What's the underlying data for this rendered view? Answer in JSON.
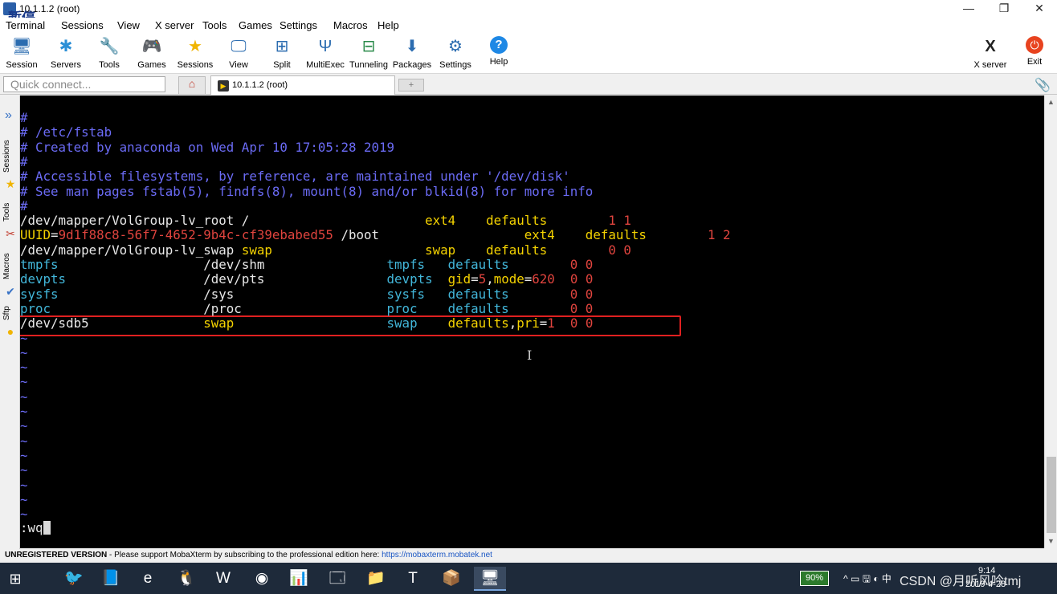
{
  "window": {
    "title": "10.1.1.2 (root)",
    "overlay_text": "暂停",
    "minimize": "—",
    "maximize": "❐",
    "close": "✕"
  },
  "menu": [
    "Terminal",
    "Sessions",
    "View",
    "X server",
    "Tools",
    "Games",
    "Settings",
    "Macros",
    "Help"
  ],
  "toolbar": [
    {
      "label": "Session",
      "icon": "session-icon",
      "glyph": "🖥",
      "color": "#2b6cb0"
    },
    {
      "label": "Servers",
      "icon": "servers-icon",
      "glyph": "✱",
      "color": "#2b8fd6"
    },
    {
      "label": "Tools",
      "icon": "tools-icon",
      "glyph": "🔧",
      "color": "#c0392b"
    },
    {
      "label": "Games",
      "icon": "games-icon",
      "glyph": "🎮",
      "color": "#555"
    },
    {
      "label": "Sessions",
      "icon": "sessions-star-icon",
      "glyph": "★",
      "color": "#f0b400"
    },
    {
      "label": "View",
      "icon": "view-icon",
      "glyph": "🖵",
      "color": "#2b6cb0"
    },
    {
      "label": "Split",
      "icon": "split-icon",
      "glyph": "⊞",
      "color": "#2b6cb0"
    },
    {
      "label": "MultiExec",
      "icon": "multiexec-icon",
      "glyph": "Ψ",
      "color": "#2b6cb0"
    },
    {
      "label": "Tunneling",
      "icon": "tunneling-icon",
      "glyph": "⊟",
      "color": "#2a8a4a"
    },
    {
      "label": "Packages",
      "icon": "packages-icon",
      "glyph": "⬇",
      "color": "#2b6cb0"
    },
    {
      "label": "Settings",
      "icon": "settings-icon",
      "glyph": "⚙",
      "color": "#2b6cb0"
    },
    {
      "label": "Help",
      "icon": "help-icon",
      "glyph": "?",
      "color": "#ffffff"
    }
  ],
  "toolbar_right": [
    {
      "label": "X server",
      "icon": "xserver-icon",
      "glyph": "X"
    },
    {
      "label": "Exit",
      "icon": "exit-icon",
      "glyph": "⏻"
    }
  ],
  "tabs": {
    "quick_connect_placeholder": "Quick connect...",
    "home_glyph": "⌂",
    "session_tab_label": "10.1.1.2 (root)",
    "new_tab_glyph": "+",
    "attach_glyph": "📎"
  },
  "sidebar": {
    "top_glyph": "»",
    "tabs": [
      "Sessions",
      "Tools",
      "Macros",
      "Sftp"
    ]
  },
  "terminal": {
    "lines": [
      [
        {
          "t": "#",
          "c": "comment"
        }
      ],
      [
        {
          "t": "# /etc/fstab",
          "c": "comment"
        }
      ],
      [
        {
          "t": "# Created by anaconda on Wed Apr 10 17:05:28 2019",
          "c": "comment"
        }
      ],
      [
        {
          "t": "#",
          "c": "comment"
        }
      ],
      [
        {
          "t": "# Accessible filesystems, by reference, are maintained under '/dev/disk'",
          "c": "comment"
        }
      ],
      [
        {
          "t": "# See man pages fstab(5), findfs(8), mount(8) and/or blkid(8) for more info",
          "c": "comment"
        }
      ],
      [
        {
          "t": "#",
          "c": "comment"
        }
      ],
      [
        {
          "t": "/dev/mapper/VolGroup-lv_root /                       ",
          "c": "white"
        },
        {
          "t": "ext4    defaults        ",
          "c": "yellow"
        },
        {
          "t": "1 1",
          "c": "red"
        }
      ],
      [
        {
          "t": "UUID",
          "c": "yellow"
        },
        {
          "t": "=",
          "c": "white"
        },
        {
          "t": "9d1f88c8-56f7-4652-9b4c-cf39ebabed55",
          "c": "red"
        },
        {
          "t": " /boot                   ",
          "c": "white"
        },
        {
          "t": "ext4    defaults        ",
          "c": "yellow"
        },
        {
          "t": "1 2",
          "c": "red"
        }
      ],
      [
        {
          "t": "/dev/mapper/VolGroup-lv_swap ",
          "c": "white"
        },
        {
          "t": "swap",
          "c": "yellow"
        },
        {
          "t": "                    ",
          "c": "white"
        },
        {
          "t": "swap    defaults        ",
          "c": "yellow"
        },
        {
          "t": "0 0",
          "c": "red"
        }
      ],
      [
        {
          "t": "tmpfs",
          "c": "cyan"
        },
        {
          "t": "                   /dev/shm                ",
          "c": "white"
        },
        {
          "t": "tmpfs   defaults        ",
          "c": "cyan"
        },
        {
          "t": "0 0",
          "c": "red"
        }
      ],
      [
        {
          "t": "devpts",
          "c": "cyan"
        },
        {
          "t": "                  /dev/pts                ",
          "c": "white"
        },
        {
          "t": "devpts  ",
          "c": "cyan"
        },
        {
          "t": "gid",
          "c": "yellow"
        },
        {
          "t": "=",
          "c": "white"
        },
        {
          "t": "5",
          "c": "red"
        },
        {
          "t": ",",
          "c": "white"
        },
        {
          "t": "mode",
          "c": "yellow"
        },
        {
          "t": "=",
          "c": "white"
        },
        {
          "t": "620",
          "c": "red"
        },
        {
          "t": "  ",
          "c": "white"
        },
        {
          "t": "0 0",
          "c": "red"
        }
      ],
      [
        {
          "t": "sysfs",
          "c": "cyan"
        },
        {
          "t": "                   /sys                    ",
          "c": "white"
        },
        {
          "t": "sysfs   defaults        ",
          "c": "cyan"
        },
        {
          "t": "0 0",
          "c": "red"
        }
      ],
      [
        {
          "t": "proc",
          "c": "cyan"
        },
        {
          "t": "                    /proc                   ",
          "c": "white"
        },
        {
          "t": "proc    defaults        ",
          "c": "cyan"
        },
        {
          "t": "0 0",
          "c": "red"
        }
      ],
      [
        {
          "t": "/dev/sdb5               ",
          "c": "white"
        },
        {
          "t": "swap                    ",
          "c": "yellow"
        },
        {
          "t": "swap    ",
          "c": "cyan"
        },
        {
          "t": "defaults",
          "c": "yellow"
        },
        {
          "t": ",",
          "c": "white"
        },
        {
          "t": "pri",
          "c": "yellow"
        },
        {
          "t": "=",
          "c": "white"
        },
        {
          "t": "1",
          "c": "red"
        },
        {
          "t": "  ",
          "c": "white"
        },
        {
          "t": "0 0",
          "c": "red"
        }
      ],
      [
        {
          "t": "~",
          "c": "tilde"
        }
      ],
      [
        {
          "t": "~",
          "c": "tilde"
        }
      ],
      [
        {
          "t": "~",
          "c": "tilde"
        }
      ],
      [
        {
          "t": "~",
          "c": "tilde"
        }
      ],
      [
        {
          "t": "~",
          "c": "tilde"
        }
      ],
      [
        {
          "t": "~",
          "c": "tilde"
        }
      ],
      [
        {
          "t": "~",
          "c": "tilde"
        }
      ],
      [
        {
          "t": "~",
          "c": "tilde"
        }
      ],
      [
        {
          "t": "~",
          "c": "tilde"
        }
      ],
      [
        {
          "t": "~",
          "c": "tilde"
        }
      ],
      [
        {
          "t": "~",
          "c": "tilde"
        }
      ],
      [
        {
          "t": "~",
          "c": "tilde"
        }
      ],
      [
        {
          "t": "~",
          "c": "tilde"
        }
      ]
    ],
    "command": ":wq",
    "ibeam_glyph": "I"
  },
  "statusbar": {
    "unregistered": "UNREGISTERED VERSION",
    "message": " -  Please support MobaXterm by subscribing to the professional edition here: ",
    "link": "https://mobaxterm.mobatek.net"
  },
  "taskbar": {
    "start_glyph": "⊞",
    "apps": [
      {
        "name": "taskbar-app-1",
        "glyph": "🐦"
      },
      {
        "name": "taskbar-app-2",
        "glyph": "📘"
      },
      {
        "name": "taskbar-edge",
        "glyph": "e"
      },
      {
        "name": "taskbar-app-4",
        "glyph": "🐧"
      },
      {
        "name": "taskbar-word",
        "glyph": "W"
      },
      {
        "name": "taskbar-chrome",
        "glyph": "◉"
      },
      {
        "name": "taskbar-app-7",
        "glyph": "📊"
      },
      {
        "name": "taskbar-app-8",
        "glyph": "🗔"
      },
      {
        "name": "taskbar-explorer",
        "glyph": "📁"
      },
      {
        "name": "taskbar-app-10",
        "glyph": "T"
      },
      {
        "name": "taskbar-app-11",
        "glyph": "📦"
      },
      {
        "name": "taskbar-mobaxterm",
        "glyph": "🖥"
      }
    ],
    "battery": "90%",
    "tray_icons": "^ ▭ 🖫 ◐ 中",
    "watermark": "CSDN @月听风吟tmj",
    "time": "9:14",
    "date": "2019-4-28"
  }
}
